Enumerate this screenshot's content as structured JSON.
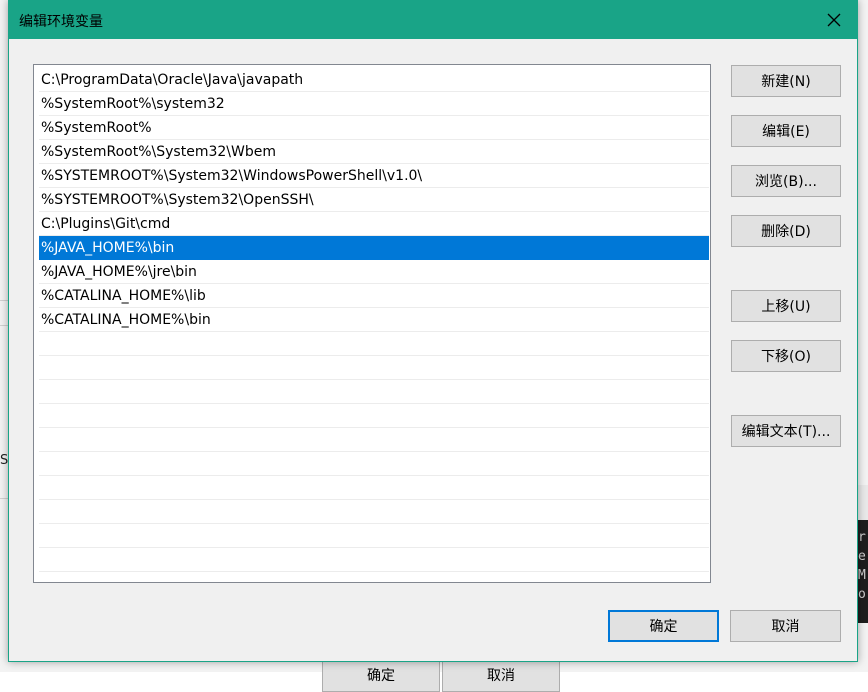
{
  "background": {
    "letter": "S",
    "console_lines": [
      "r",
      "e",
      "M",
      "o"
    ],
    "behind_buttons": [
      "确定",
      "取消"
    ]
  },
  "dialog": {
    "title": "编辑环境变量",
    "close_icon": "close-icon",
    "accent_color": "#19a487",
    "selection_color": "#0078d7"
  },
  "list": {
    "items": [
      "C:\\ProgramData\\Oracle\\Java\\javapath",
      "%SystemRoot%\\system32",
      "%SystemRoot%",
      "%SystemRoot%\\System32\\Wbem",
      "%SYSTEMROOT%\\System32\\WindowsPowerShell\\v1.0\\",
      "%SYSTEMROOT%\\System32\\OpenSSH\\",
      "C:\\Plugins\\Git\\cmd",
      "%JAVA_HOME%\\bin",
      "%JAVA_HOME%\\jre\\bin",
      "%CATALINA_HOME%\\lib",
      "%CATALINA_HOME%\\bin"
    ],
    "selected_index": 7
  },
  "buttons": {
    "new": "新建(N)",
    "edit": "编辑(E)",
    "browse": "浏览(B)...",
    "delete": "删除(D)",
    "move_up": "上移(U)",
    "move_down": "下移(O)",
    "edit_text": "编辑文本(T)...",
    "ok": "确定",
    "cancel": "取消"
  }
}
